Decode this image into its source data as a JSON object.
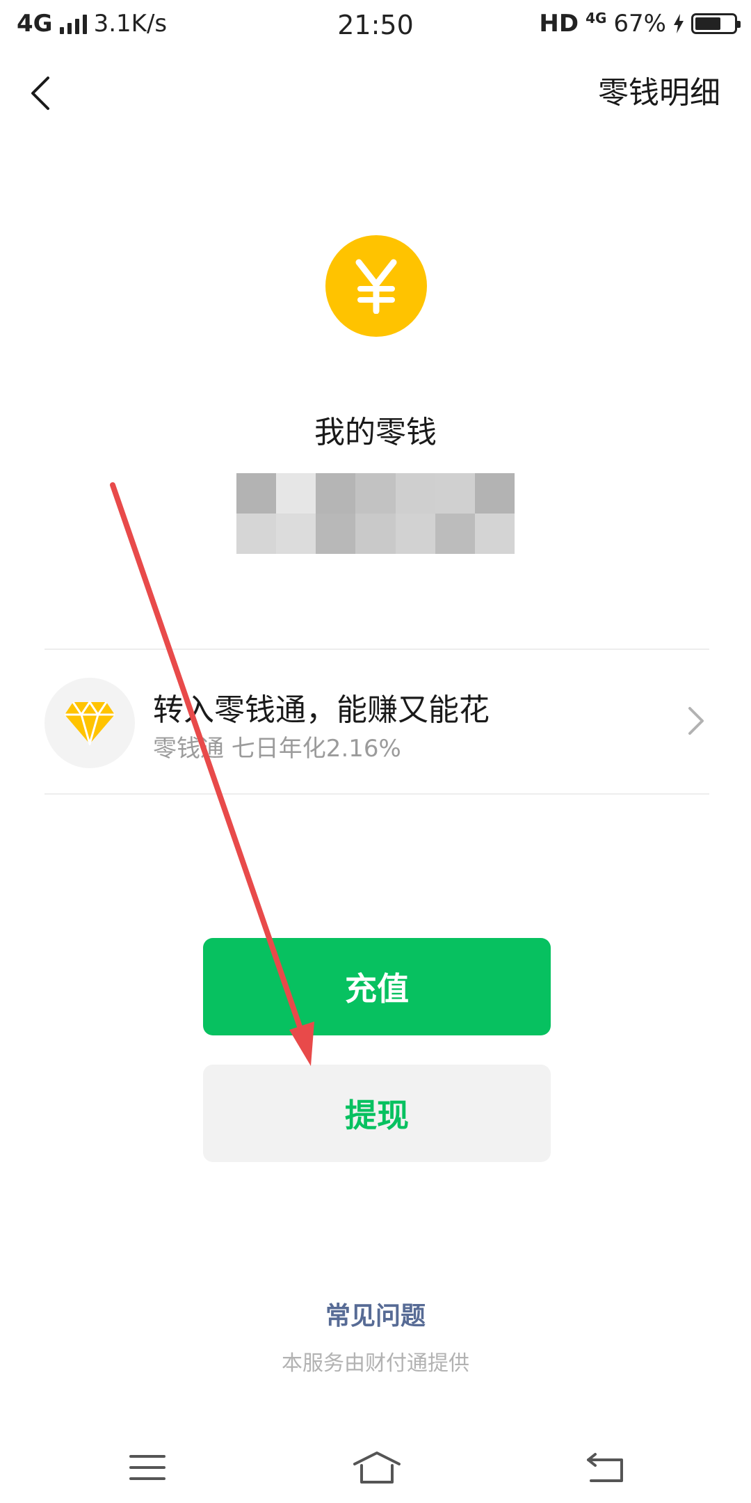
{
  "status_bar": {
    "network": "4G",
    "speed": "3.1K/s",
    "time": "21:50",
    "hd": "HD",
    "network2": "4G",
    "battery": "67%",
    "battery_level": 0.67
  },
  "nav": {
    "detail_link": "零钱明细"
  },
  "balance": {
    "title": "我的零钱"
  },
  "promo": {
    "title": "转入零钱通，能赚又能花",
    "subtitle": "零钱通 七日年化2.16%"
  },
  "buttons": {
    "recharge": "充值",
    "withdraw": "提现"
  },
  "footer": {
    "faq": "常见问题",
    "provider": "本服务由财付通提供"
  },
  "colors": {
    "brand_green": "#07c160",
    "coin_yellow": "#ffc300",
    "link_blue": "#576b95",
    "annotation_red": "#e84a4a"
  }
}
